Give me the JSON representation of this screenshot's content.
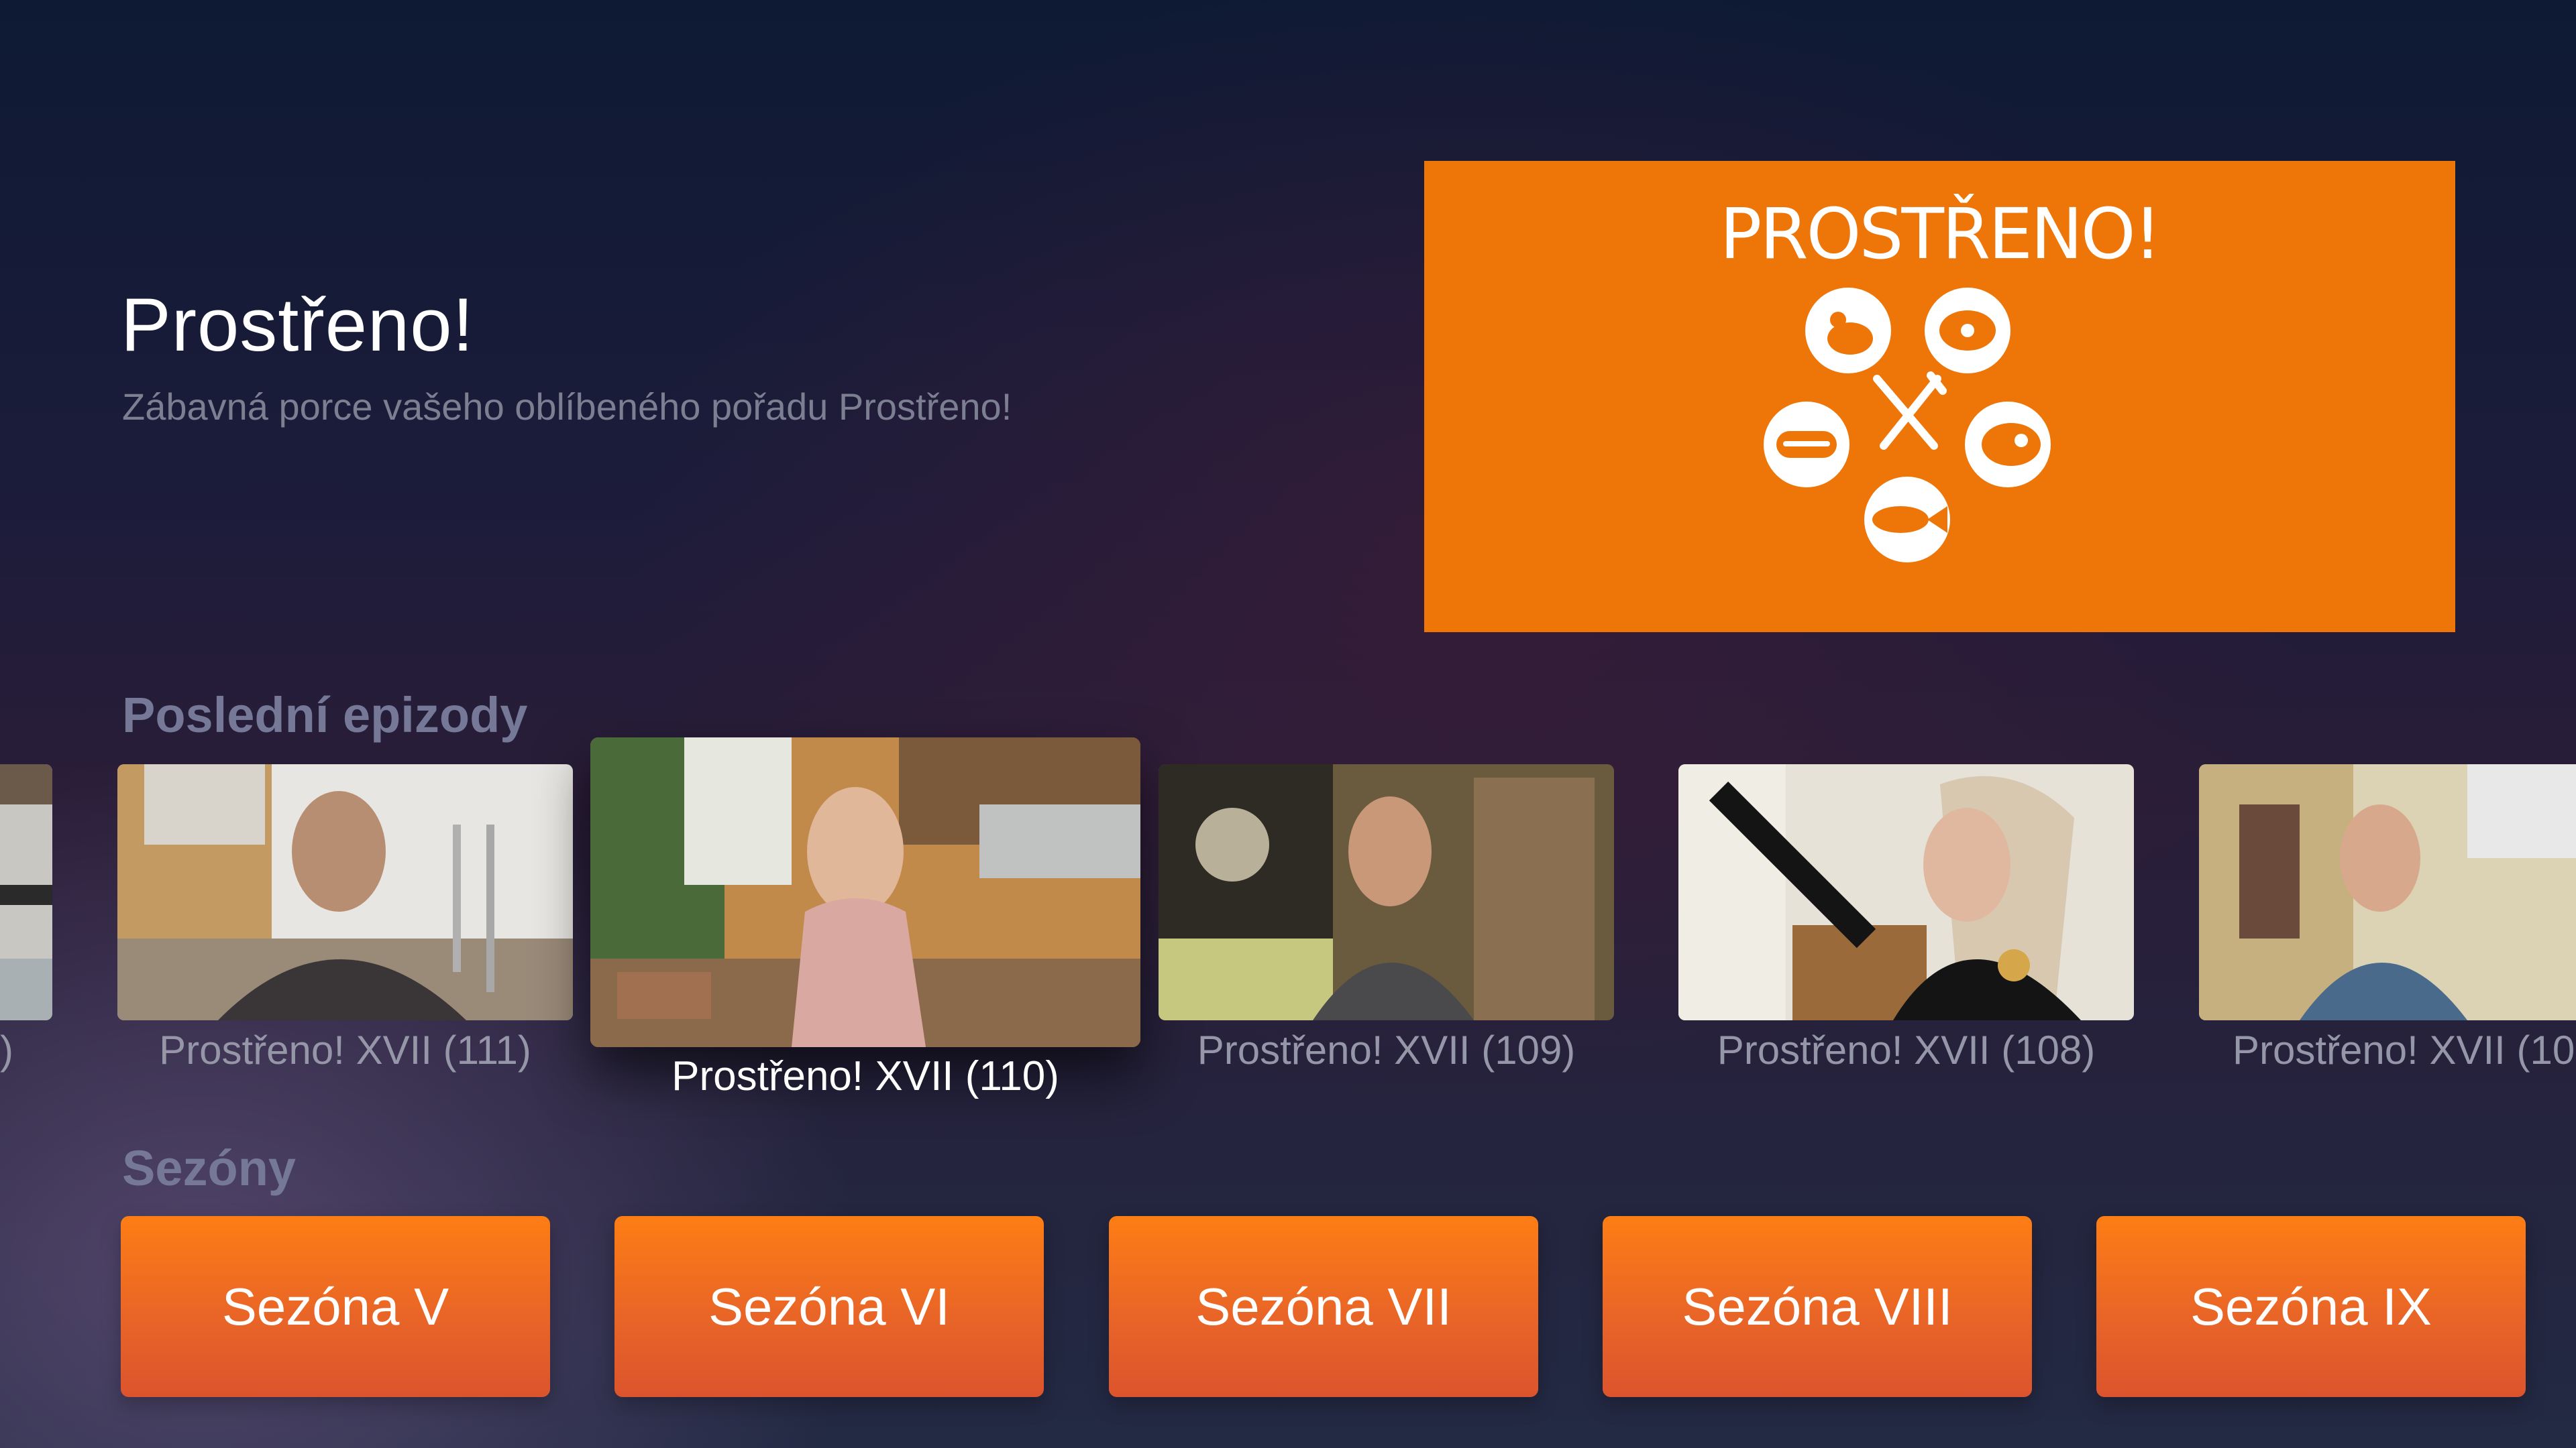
{
  "show": {
    "title": "Prostřeno!",
    "description": "Zábavná porce vašeho oblíbeného pořadu Prostřeno!",
    "hero_logo": "PROSTŘENO!",
    "hero_color": "#ee7507"
  },
  "sections": {
    "episodes_label": "Poslední epizody",
    "seasons_label": "Sezóny"
  },
  "episodes": [
    {
      "label": ")"
    },
    {
      "label": "Prostřeno! XVII (111)"
    },
    {
      "label": "Prostřeno! XVII (110)",
      "focused": true
    },
    {
      "label": "Prostřeno! XVII (109)"
    },
    {
      "label": "Prostřeno! XVII (108)"
    },
    {
      "label": "Prostřeno! XVII (10"
    }
  ],
  "seasons": [
    {
      "label": "Sezóna V"
    },
    {
      "label": "Sezóna VI"
    },
    {
      "label": "Sezóna VII"
    },
    {
      "label": "Sezóna VIII"
    },
    {
      "label": "Sezóna IX"
    }
  ],
  "colors": {
    "accent": "#ee7507",
    "button_top": "#fd7d14",
    "button_bottom": "#dc542d"
  }
}
